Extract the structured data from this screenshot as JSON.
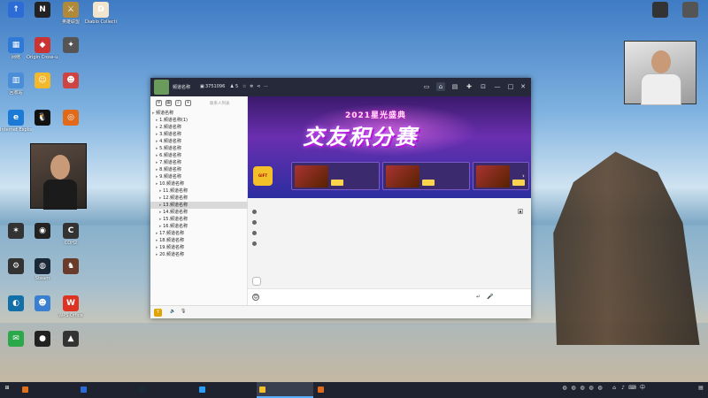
{
  "desktop": {
    "icons": [
      {
        "label": "",
        "color": "#2d6bd6",
        "glyph": "↑"
      },
      {
        "label": "",
        "color": "#222",
        "glyph": "N"
      },
      {
        "label": "英雄联盟",
        "color": "#b08a3a",
        "glyph": "⚔"
      },
      {
        "label": "Diablo Collection",
        "color": "#f1e6cd",
        "glyph": "D"
      },
      {
        "label": "网络",
        "color": "#2f7ad6",
        "glyph": "▦"
      },
      {
        "label": "Origin Cross-up",
        "color": "#c33",
        "glyph": "◆"
      },
      {
        "label": "",
        "color": "#555",
        "glyph": "✦"
      },
      {
        "label": "回收站",
        "color": "#4a8ed8",
        "glyph": "▥"
      },
      {
        "label": "",
        "color": "#f2b92e",
        "glyph": "☺"
      },
      {
        "label": "",
        "color": "#c44",
        "glyph": "☻"
      },
      {
        "label": "Internet Explorer",
        "color": "#1a7ad6",
        "glyph": "e"
      },
      {
        "label": "",
        "color": "#111",
        "glyph": "🐧"
      },
      {
        "label": "",
        "color": "#e06a1a",
        "glyph": "◎"
      },
      {
        "label": "",
        "color": "#333",
        "glyph": "✶"
      },
      {
        "label": "",
        "color": "#222",
        "glyph": "◉"
      },
      {
        "label": "COH2",
        "color": "#333",
        "glyph": "C"
      },
      {
        "label": "",
        "color": "#333",
        "glyph": "⚙"
      },
      {
        "label": "Steam",
        "color": "#1b2838",
        "glyph": "◍"
      },
      {
        "label": "",
        "color": "#6a3b2a",
        "glyph": "♞"
      },
      {
        "label": "",
        "color": "#136fa8",
        "glyph": "◐"
      },
      {
        "label": "",
        "color": "#3a7fd0",
        "glyph": "☻"
      },
      {
        "label": "WPS Office",
        "color": "#d32",
        "glyph": "W"
      },
      {
        "label": "",
        "color": "#2aa84a",
        "glyph": "✉"
      },
      {
        "label": "",
        "color": "#222",
        "glyph": "●"
      },
      {
        "label": "",
        "color": "#333",
        "glyph": "▲"
      }
    ],
    "topright_icons": [
      {
        "label": "",
        "color": "#333"
      },
      {
        "label": "",
        "color": "#555"
      }
    ]
  },
  "window": {
    "channel_name": "频道名称",
    "channel_id": "3751096",
    "user_count": "5",
    "left_tools_text": "联系人列表",
    "channels": [
      "频道名称",
      "1.频道名称(1)",
      "2.频道名称",
      "3.频道名称",
      "4.频道名称",
      "5.频道名称",
      "6.频道名称",
      "7.频道名称",
      "8.频道名称",
      "9.频道名称",
      "10.频道名称",
      "11.频道名称",
      "12.频道名称",
      "13.频道名称",
      "14.频道名称",
      "15.频道名称",
      "16.频道名称",
      "17.频道名称",
      "18.频道名称",
      "19.频道名称",
      "20.频道名称"
    ],
    "selected_channel_index": 13,
    "banner": {
      "subtitle": "2021星光盛典",
      "title": "交友积分赛",
      "cards": [
        {
          "tag": "",
          "name": "",
          "button": ""
        },
        {
          "tag": "",
          "name": "",
          "button": ""
        },
        {
          "tag": "",
          "name": "",
          "button": ""
        },
        {
          "tag": "",
          "name": "",
          "button": ""
        }
      ]
    },
    "messages": [
      {
        "tag": "",
        "text": ""
      },
      {
        "tag": "",
        "text": ""
      },
      {
        "tag": "",
        "text": ""
      },
      {
        "tag": "",
        "text": ""
      }
    ],
    "quick_reply": "",
    "input_placeholder": "",
    "send_label": "",
    "bottom_items": [
      "",
      "",
      "",
      "",
      "",
      "",
      ""
    ]
  },
  "taskbar": {
    "items": [
      {
        "label": "",
        "color": "#e0701a",
        "active": false
      },
      {
        "label": "",
        "color": "#2b6bd6",
        "active": false
      },
      {
        "label": "",
        "color": "#1b2838",
        "active": false
      },
      {
        "label": "",
        "color": "#2a9df4",
        "active": false
      },
      {
        "label": "",
        "color": "#f3c02a",
        "active": true
      },
      {
        "label": "",
        "color": "#e06a1a",
        "active": false
      }
    ],
    "clock_time": "",
    "clock_date": ""
  }
}
